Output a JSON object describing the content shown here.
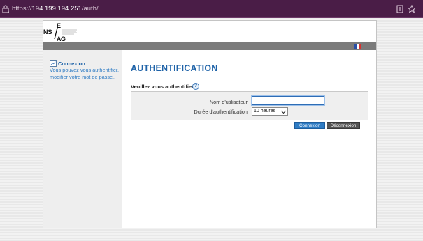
{
  "browser": {
    "url_prefix": "https://",
    "url_host": "194.199.194.251",
    "url_path": "/auth/"
  },
  "header": {
    "logo_text": [
      "E",
      "NS",
      "A",
      "G"
    ],
    "language_flag": "fr-flag-icon"
  },
  "sidebar": {
    "title": "Connexion",
    "description": "Vous pouvez vous authentifier, modifier votre mot de passe.."
  },
  "main": {
    "page_title": "AUTHENTIFICATION",
    "form_title": "Veuillez vous authentifier",
    "fields": {
      "username_label": "Nom d'utilisateur",
      "username_value": "",
      "duration_label": "Durée d'authentification",
      "duration_value": "10 heures"
    },
    "buttons": {
      "login": "Connexion",
      "logout": "Déconnexion"
    }
  },
  "colors": {
    "url_bar": "#4a1d47",
    "accent_blue": "#1f63a8",
    "header_bar": "#7b7b7b",
    "login_button": "#2f7cc4",
    "logout_button": "#555555"
  }
}
